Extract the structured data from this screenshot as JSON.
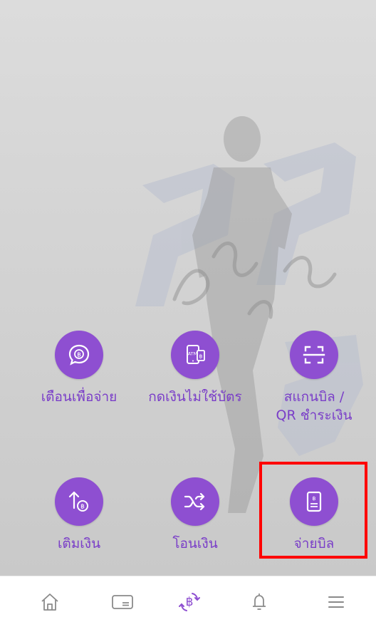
{
  "actions": [
    {
      "label": "เตือนเพื่อจ่าย",
      "icon": "bill-reminder-icon"
    },
    {
      "label": "กดเงินไม่ใช้บัตร",
      "icon": "cardless-atm-icon"
    },
    {
      "label": "สแกนบิล /\nQR ชำระเงิน",
      "icon": "scan-qr-icon"
    },
    {
      "label": "เติมเงิน",
      "icon": "top-up-icon"
    },
    {
      "label": "โอนเงิน",
      "icon": "transfer-icon"
    },
    {
      "label": "จ่ายบิล",
      "icon": "pay-bill-icon"
    }
  ],
  "icon_labels": {
    "atm": "ATM",
    "baht": "฿"
  },
  "tabbar": [
    {
      "name": "home",
      "icon": "home-icon"
    },
    {
      "name": "cards",
      "icon": "card-icon"
    },
    {
      "name": "transactions",
      "icon": "baht-exchange-icon"
    },
    {
      "name": "notifications",
      "icon": "bell-icon"
    },
    {
      "name": "menu",
      "icon": "hamburger-menu-icon"
    }
  ],
  "colors": {
    "accent": "#8e4fd1",
    "label": "#7a3ec8",
    "highlight": "#ff0000",
    "tab_icon": "#8a8a8a"
  }
}
